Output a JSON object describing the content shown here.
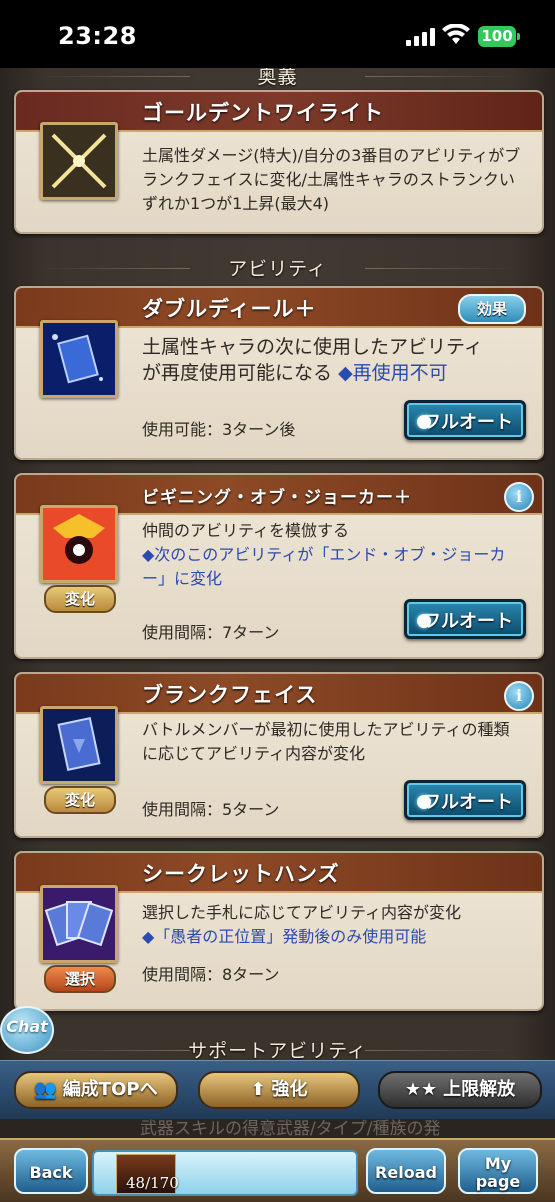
{
  "status_bar": {
    "time": "23:28",
    "battery": "100"
  },
  "sections": {
    "ougi": "奥義",
    "abilities": "アビリティ",
    "support": "サポートアビリティ"
  },
  "ougi_card": {
    "title": "ゴールデントワイライト",
    "desc": "土属性ダメージ(特大)/自分の3番目のアビリティがブランクフェイスに変化/土属性キャラのストランクいずれか1つが1上昇(最大4)"
  },
  "abilities": [
    {
      "title": "ダブルディール＋",
      "badge": "効果",
      "desc_line1": "土属性キャラの次に使用したアビリティ",
      "desc_line2": "が再度使用可能になる",
      "desc_note": "◆再使用不可",
      "status": "使用可能：3ターン後",
      "button": "フルオート"
    },
    {
      "title": "ビギニング・オブ・ジョーカー＋",
      "desc_line1": "仲間のアビリティを模倣する",
      "desc_note": "◆次のこのアビリティが「エンド・オブ・ジョーカー」に変化",
      "status": "使用間隔：7ターン",
      "tag": "変化",
      "button": "フルオート"
    },
    {
      "title": "ブランクフェイス",
      "desc_line1": "バトルメンバーが最初に使用したアビリティの種類に応じてアビリティ内容が変化",
      "status": "使用間隔：5ターン",
      "tag": "変化",
      "button": "フルオート"
    },
    {
      "title": "シークレットハンズ",
      "desc_line1": "選択した手札に応じてアビリティ内容が変化",
      "desc_note": "◆「愚者の正位置」発動後のみ使用可能",
      "status": "使用間隔：8ターン",
      "tag": "選択"
    }
  ],
  "chat_label": "Chat",
  "action_bar": {
    "party_top": "編成TOPへ",
    "enhance": "強化",
    "uncap": "上限解放"
  },
  "support_partial": "武器スキルの得意武器/タイプ/種族の発",
  "nav": {
    "back": "Back",
    "stamina": "48/170",
    "reload": "Reload",
    "my_page_1": "My",
    "my_page_2": "page"
  },
  "colors": {
    "title_bar": "#7a3a1c",
    "card_bg": "#efe6d6",
    "note_blue": "#2a4bb0",
    "status_red": "#d11d1d",
    "button_blue": "#0d4a6a"
  }
}
